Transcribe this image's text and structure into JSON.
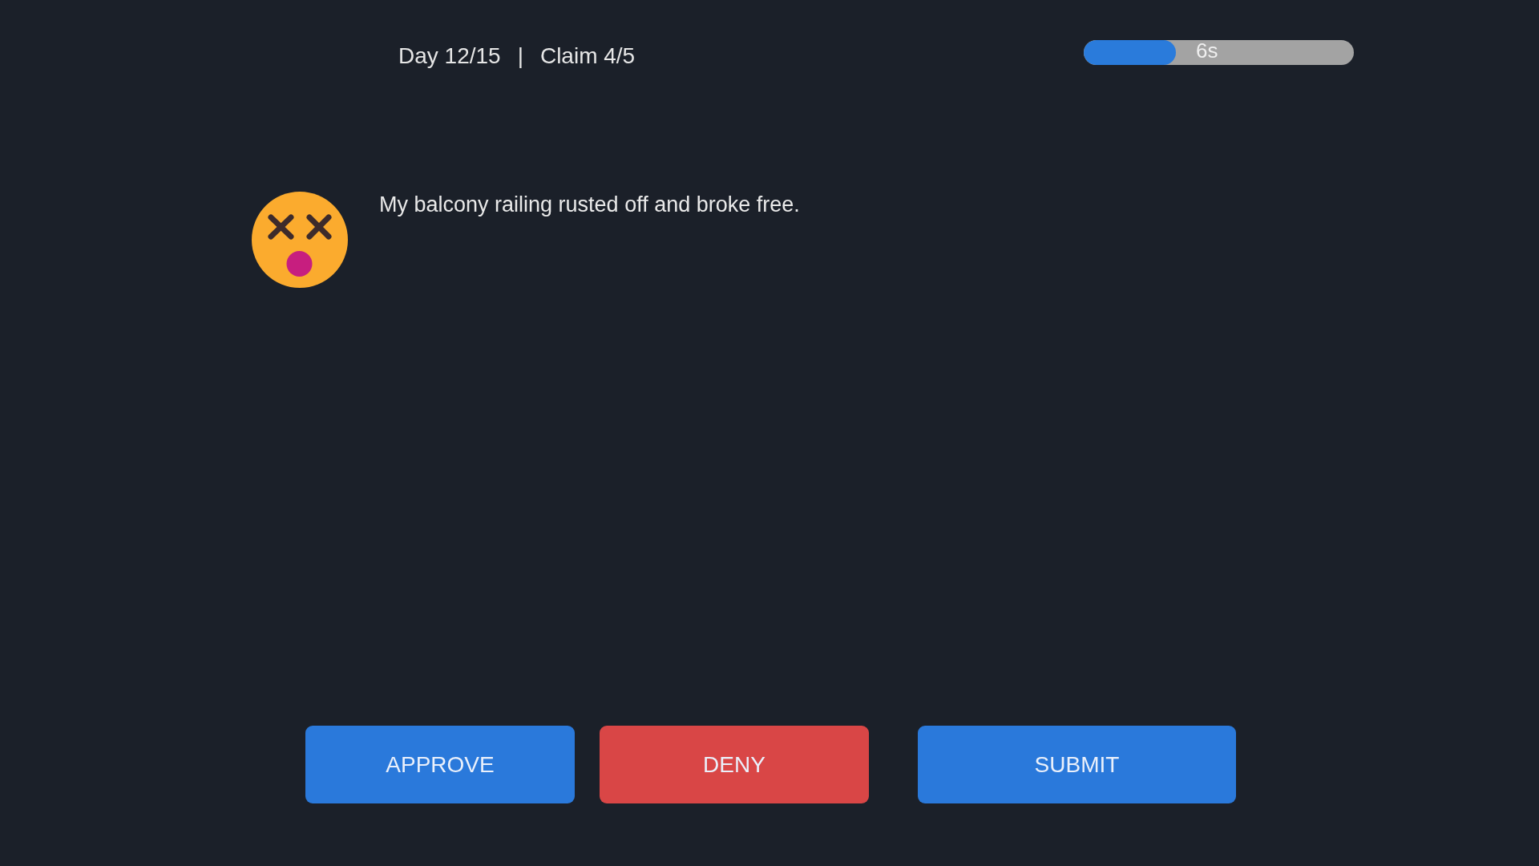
{
  "header": {
    "day": "Day 12/15",
    "separator": "|",
    "claim": "Claim 4/5"
  },
  "timer": {
    "level": 0.34,
    "label": "6s"
  },
  "claim": {
    "message": "My balcony railing rusted off and broke free."
  },
  "buttons": [
    {
      "label": "APPROVE",
      "kind": "approve"
    },
    {
      "label": "DENY",
      "kind": "deny"
    },
    {
      "label": "SUBMIT",
      "kind": "submit"
    }
  ]
}
